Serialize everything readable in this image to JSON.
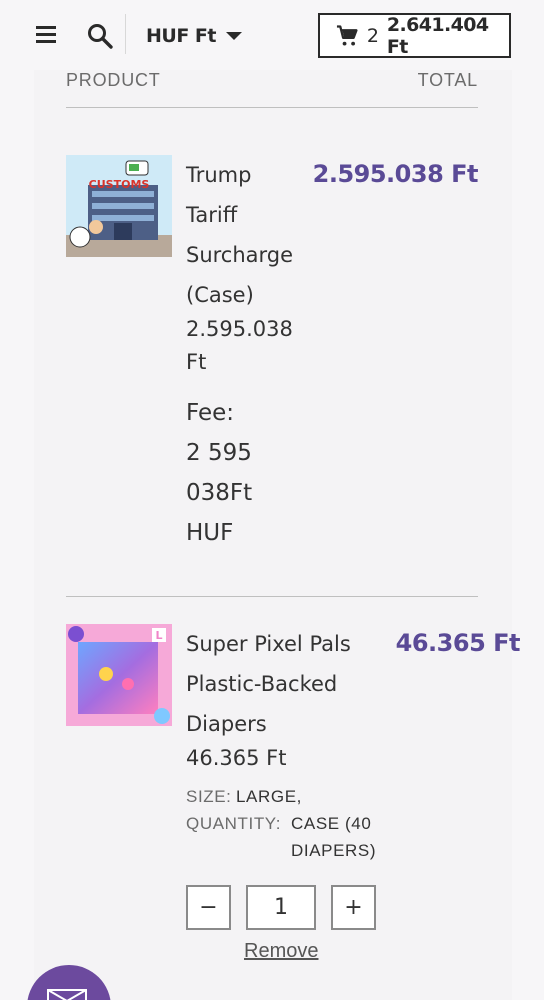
{
  "header": {
    "currency_label": "HUF Ft",
    "cart_count": "2",
    "cart_total": "2.641.404 Ft"
  },
  "table": {
    "col_product": "PRODUCT",
    "col_total": "TOTAL"
  },
  "items": [
    {
      "name_lines": [
        "Trump",
        "Tariff",
        "Surcharge",
        "(Case)"
      ],
      "price_lines": [
        "2.595.038",
        "Ft"
      ],
      "fee_lines": [
        "Fee:",
        "2 595",
        "038Ft",
        "HUF"
      ],
      "line_total": "2.595.038 Ft",
      "image_text": "CUSTOMS"
    },
    {
      "name_lines": [
        "Super Pixel Pals",
        "Plastic-Backed",
        "Diapers"
      ],
      "price_line": "46.365 Ft",
      "size_label": "SIZE:",
      "size_value": "LARGE,",
      "quantity_label": "QUANTITY:",
      "quantity_value_lines": [
        "CASE (40",
        "DIAPERS)"
      ],
      "qty_minus": "−",
      "qty_value": "1",
      "qty_plus": "+",
      "remove_label": "Remove",
      "line_total": "46.365 Ft",
      "image_text": "L"
    }
  ],
  "colors": {
    "accent": "#5a4a96",
    "chat": "#6c4a9e"
  }
}
